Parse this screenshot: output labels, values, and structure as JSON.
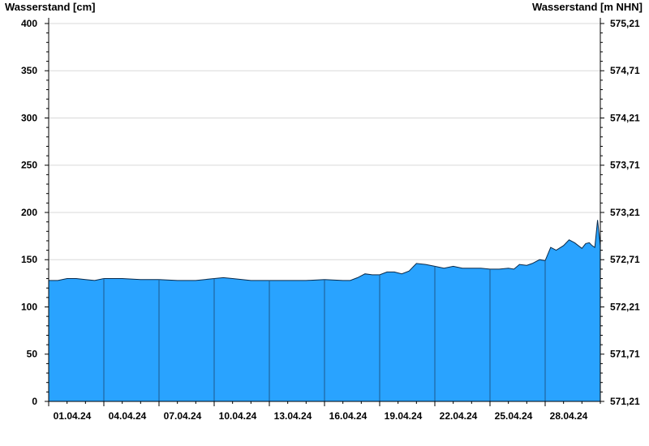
{
  "chart_data": {
    "type": "area",
    "ylabel": "Wasserstand [cm]",
    "ylabel_right": "Wasserstand [m NHN]",
    "ylim": [
      0,
      406
    ],
    "yticks": [
      0,
      50,
      100,
      150,
      200,
      250,
      300,
      350,
      400
    ],
    "yticks_right": [
      "571,21",
      "571,71",
      "572,21",
      "572,71",
      "573,21",
      "573,71",
      "574,21",
      "574,71",
      "575,21"
    ],
    "xticks": [
      "01.04.24",
      "04.04.24",
      "07.04.24",
      "10.04.24",
      "13.04.24",
      "16.04.24",
      "19.04.24",
      "22.04.24",
      "25.04.24",
      "28.04.24"
    ],
    "x_unit": "day of April 2024",
    "xlim": [
      1,
      31
    ],
    "grid": true,
    "fill_color": "#29a3ff",
    "series": [
      {
        "x": [
          1.0,
          1.5,
          2.0,
          2.5,
          3.0,
          3.5,
          4.0,
          5.0,
          6.0,
          7.0,
          8.0,
          9.0,
          10.0,
          10.5,
          11.0,
          12.0,
          13.0,
          14.0,
          15.0,
          16.0,
          17.0,
          17.4,
          17.8,
          18.2,
          18.6,
          19.0,
          19.4,
          19.8,
          20.2,
          20.6,
          21.0,
          21.5,
          22.0,
          22.5,
          23.0,
          23.5,
          24.0,
          24.5,
          25.0,
          25.5,
          26.0,
          26.3,
          26.6,
          27.0,
          27.3,
          27.7,
          28.0,
          28.3,
          28.6,
          29.0,
          29.3,
          29.6,
          30.0,
          30.2,
          30.4,
          30.55,
          30.7,
          30.85,
          31.0
        ],
        "y": [
          128,
          128,
          130,
          130,
          129,
          128,
          130,
          130,
          129,
          129,
          128,
          128,
          130,
          131,
          130,
          128,
          128,
          128,
          128,
          129,
          128,
          128,
          131,
          135,
          134,
          134,
          137,
          137,
          135,
          138,
          146,
          145,
          143,
          141,
          143,
          141,
          141,
          141,
          140,
          140,
          141,
          140,
          145,
          144,
          146,
          150,
          149,
          163,
          160,
          165,
          171,
          168,
          162,
          167,
          168,
          165,
          163,
          192,
          165
        ]
      }
    ]
  }
}
